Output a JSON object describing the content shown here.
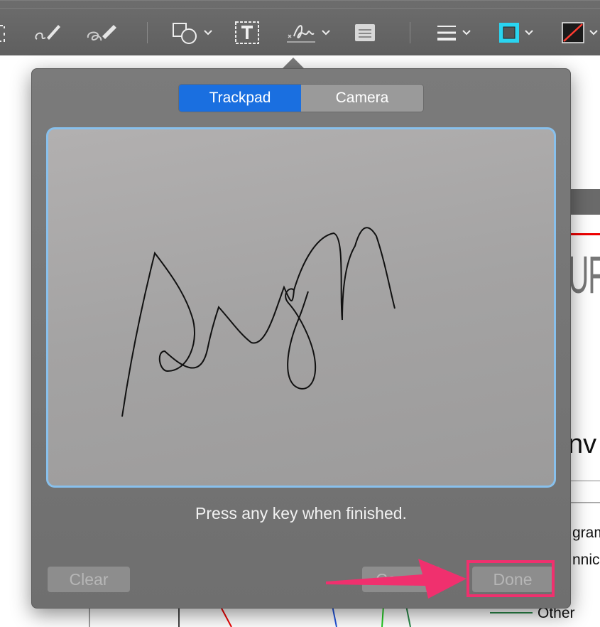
{
  "toolbar": {
    "icons": [
      "selection-icon",
      "sketch-icon",
      "draw-icon",
      "shapes-icon",
      "text-box-icon",
      "signature-icon",
      "note-icon",
      "line-style-icon",
      "border-color-icon",
      "fill-color-icon"
    ]
  },
  "background_doc": {
    "heading_fragment": "UF",
    "subheading_fragment": "nv",
    "line1": "gram",
    "line2": "nnica",
    "legend_other": "Other"
  },
  "signature_popover": {
    "tabs": [
      {
        "label": "Trackpad",
        "selected": true
      },
      {
        "label": "Camera",
        "selected": false
      }
    ],
    "instruction": "Press any key when finished.",
    "buttons": {
      "clear": "Clear",
      "cancel": "Cancel",
      "done": "Done"
    }
  },
  "annotation": {
    "highlight_color": "#f0306e",
    "arrow_color": "#f0306e"
  }
}
